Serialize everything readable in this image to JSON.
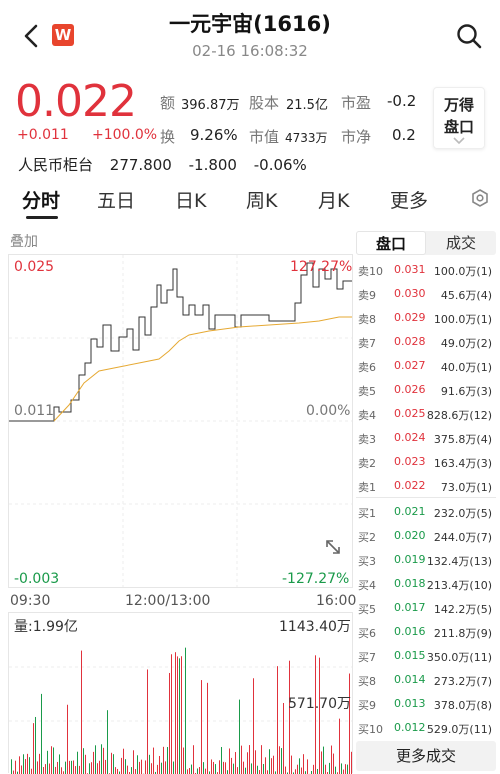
{
  "header": {
    "title": "一元宇宙(1616)",
    "datetime": "02-16 16:08:32",
    "logo_letter": "W"
  },
  "quote": {
    "price": "0.022",
    "change": "+0.011",
    "change_pct": "+100.0%",
    "metrics": {
      "amount_label": "额",
      "amount_value": "396.87万",
      "capital_label": "股本",
      "capital_value": "21.5亿",
      "pe_label": "市盈",
      "pe_value": "-0.2",
      "turnover_label": "换",
      "turnover_value": "9.26%",
      "mktcap_label": "市值",
      "mktcap_value": "4733万",
      "pb_label": "市净",
      "pb_value": "0.2"
    },
    "wind_button": [
      "万得",
      "盘口"
    ],
    "rmb_counter": "人民币柜台",
    "rmb_price": "277.800",
    "rmb_change": "-1.800",
    "rmb_pct": "-0.06%"
  },
  "tabs": [
    "分时",
    "五日",
    "日K",
    "周K",
    "月K",
    "更多"
  ],
  "chart": {
    "overlay_label": "叠加",
    "y_top": "0.025",
    "y_mid": "0.011",
    "y_bot": "-0.003",
    "pct_top": "127.27%",
    "pct_mid": "0.00%",
    "pct_bot": "-127.27%",
    "times": [
      "09:30",
      "12:00/13:00",
      "16:00"
    ],
    "volume_label": "量:1.99亿",
    "volume_max": "1143.40万",
    "volume_mid": "571.70万",
    "colors": {
      "price_line": "#333333",
      "avg_line": "#e6a933",
      "up": "#e0323c",
      "down": "#1a9a4a"
    }
  },
  "orderbook": {
    "tabs": [
      "盘口",
      "成交"
    ],
    "asks": [
      {
        "label": "卖10",
        "price": "0.031",
        "vol": "100.0万(1)"
      },
      {
        "label": "卖9",
        "price": "0.030",
        "vol": "45.6万(4)"
      },
      {
        "label": "卖8",
        "price": "0.029",
        "vol": "100.0万(1)"
      },
      {
        "label": "卖7",
        "price": "0.028",
        "vol": "49.0万(2)"
      },
      {
        "label": "卖6",
        "price": "0.027",
        "vol": "40.0万(1)"
      },
      {
        "label": "卖5",
        "price": "0.026",
        "vol": "91.6万(3)"
      },
      {
        "label": "卖4",
        "price": "0.025",
        "vol": "828.6万(12)"
      },
      {
        "label": "卖3",
        "price": "0.024",
        "vol": "375.8万(4)"
      },
      {
        "label": "卖2",
        "price": "0.023",
        "vol": "163.4万(3)"
      },
      {
        "label": "卖1",
        "price": "0.022",
        "vol": "73.0万(1)"
      }
    ],
    "bids": [
      {
        "label": "买1",
        "price": "0.021",
        "vol": "232.0万(5)"
      },
      {
        "label": "买2",
        "price": "0.020",
        "vol": "244.0万(7)"
      },
      {
        "label": "买3",
        "price": "0.019",
        "vol": "132.4万(13)"
      },
      {
        "label": "买4",
        "price": "0.018",
        "vol": "213.4万(10)"
      },
      {
        "label": "买5",
        "price": "0.017",
        "vol": "142.2万(5)"
      },
      {
        "label": "买6",
        "price": "0.016",
        "vol": "211.8万(9)"
      },
      {
        "label": "买7",
        "price": "0.015",
        "vol": "350.0万(11)"
      },
      {
        "label": "买8",
        "price": "0.014",
        "vol": "273.2万(7)"
      },
      {
        "label": "买9",
        "price": "0.013",
        "vol": "378.0万(8)"
      },
      {
        "label": "买10",
        "price": "0.012",
        "vol": "529.0万(11)"
      }
    ],
    "more_button": "更多成交"
  }
}
